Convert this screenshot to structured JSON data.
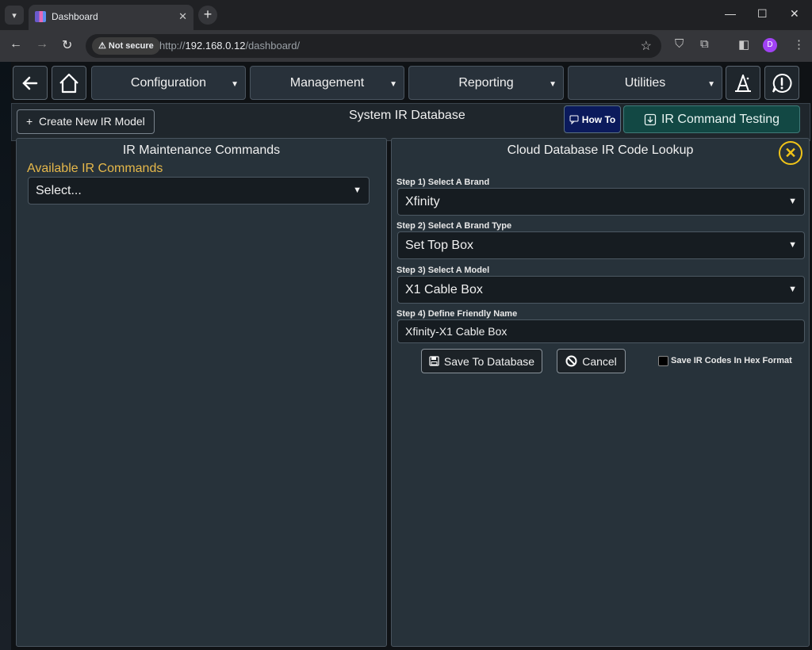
{
  "browser": {
    "tab_title": "Dashboard",
    "not_secure_label": "Not secure",
    "url_prefix": "http://",
    "url_host": "192.168.0.12",
    "url_path": "/dashboard/",
    "profile_initial": "D"
  },
  "nav": {
    "menus": [
      {
        "label": "Configuration"
      },
      {
        "label": "Management"
      },
      {
        "label": "Reporting"
      },
      {
        "label": "Utilities"
      }
    ]
  },
  "subbar": {
    "create_label": "Create New IR Model",
    "page_title": "System IR Database",
    "howto_label": "How To",
    "ir_testing_label": "IR Command Testing"
  },
  "left_panel": {
    "title": "IR Maintenance Commands",
    "available_label": "Available IR Commands",
    "select_value": "Select..."
  },
  "right_panel": {
    "title": "Cloud Database IR Code Lookup",
    "step1_label": "Step 1) Select A Brand",
    "step1_value": "Xfinity",
    "step2_label": "Step 2) Select A Brand Type",
    "step2_value": "Set Top Box",
    "step3_label": "Step 3) Select A Model",
    "step3_value": "X1 Cable Box",
    "step4_label": "Step 4) Define Friendly Name",
    "step4_value": "Xfinity-X1 Cable Box",
    "save_label": "Save To Database",
    "cancel_label": "Cancel",
    "hex_label": "Save IR Codes In Hex Format"
  }
}
